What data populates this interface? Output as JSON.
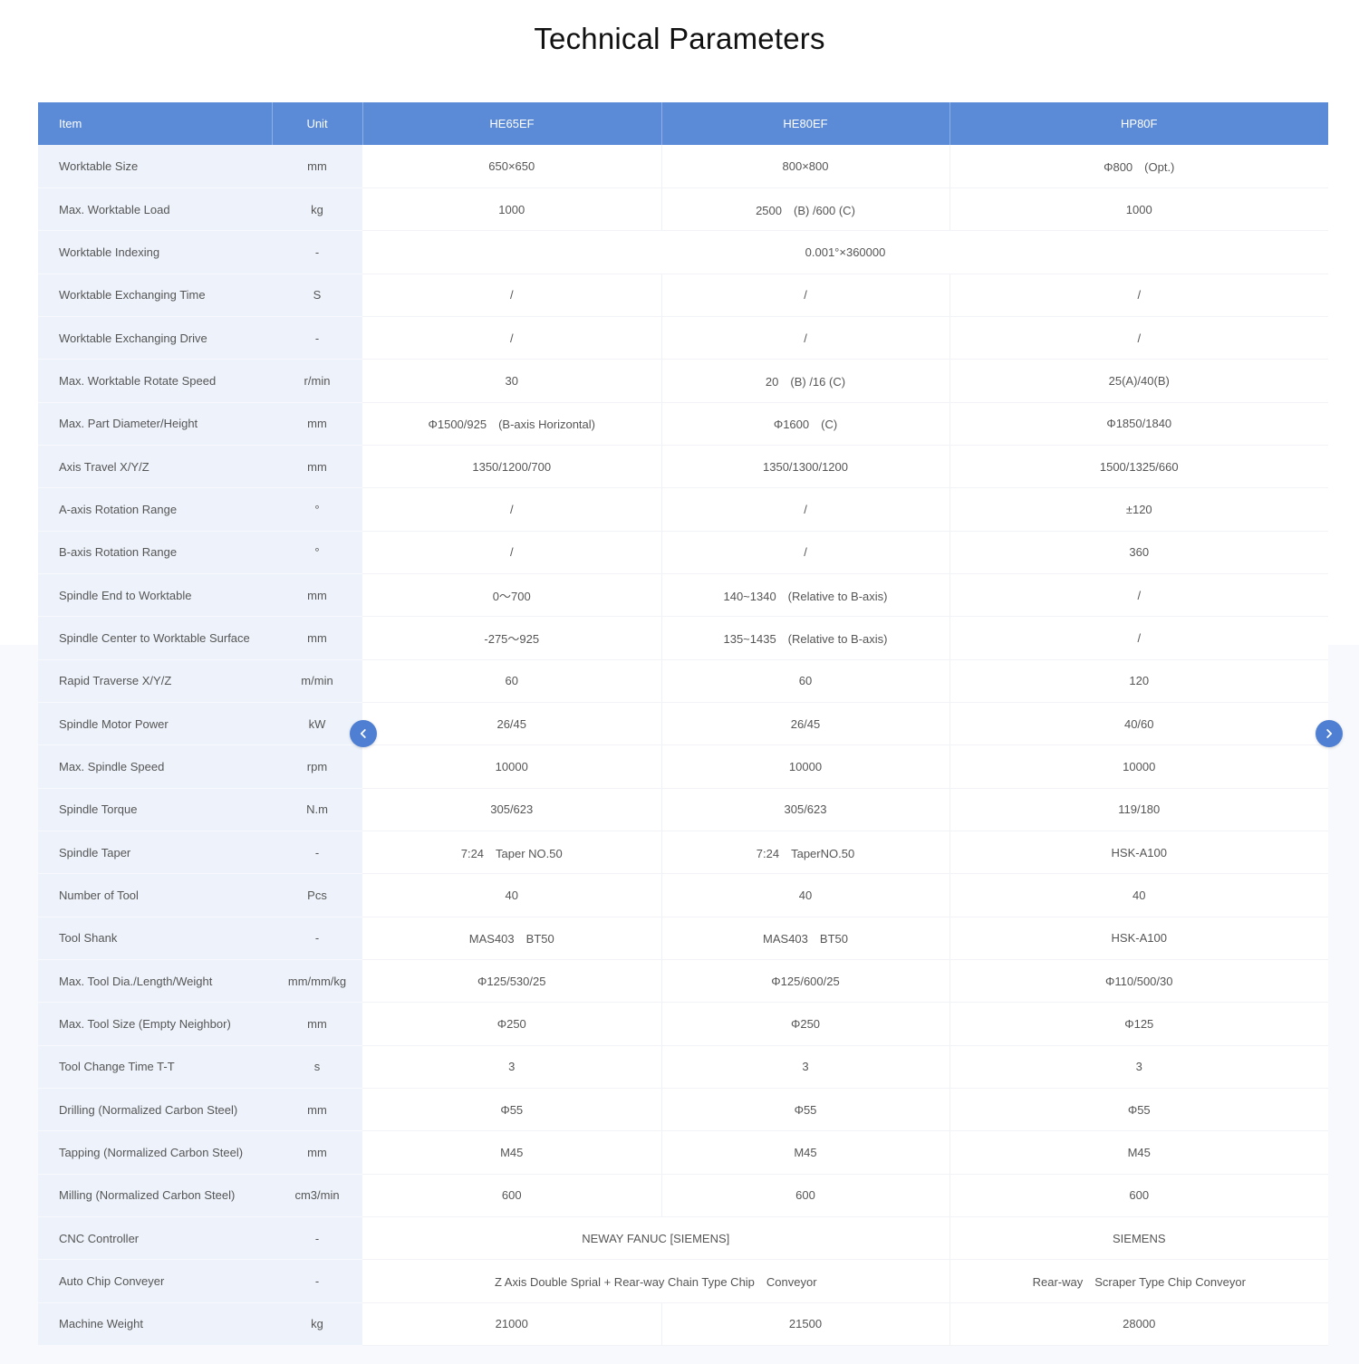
{
  "title": "Technical Parameters",
  "columns": {
    "item": "Item",
    "unit": "Unit",
    "models": [
      "HE65EF",
      "HE80EF",
      "HP80F"
    ]
  },
  "rows": [
    {
      "item": "Worktable Size",
      "unit": "mm",
      "values": [
        "650×650",
        "800×800",
        "Φ800　(Opt.)"
      ]
    },
    {
      "item": "Max. Worktable Load",
      "unit": "kg",
      "values": [
        "1000",
        "2500　(B) /600 (C)",
        "1000"
      ]
    },
    {
      "item": "Worktable Indexing",
      "unit": "-",
      "span": "0.001°×360000"
    },
    {
      "item": "Worktable Exchanging Time",
      "unit": "S",
      "values": [
        "/",
        "/",
        "/"
      ]
    },
    {
      "item": "Worktable Exchanging Drive",
      "unit": "-",
      "values": [
        "/",
        "/",
        "/"
      ]
    },
    {
      "item": "Max. Worktable Rotate Speed",
      "unit": "r/min",
      "values": [
        "30",
        "20　(B) /16 (C)",
        "25(A)/40(B)"
      ]
    },
    {
      "item": "Max. Part Diameter/Height",
      "unit": "mm",
      "values": [
        "Φ1500/925　(B-axis Horizontal)",
        "Φ1600　(C)",
        "Φ1850/1840"
      ]
    },
    {
      "item": "Axis Travel X/Y/Z",
      "unit": "mm",
      "values": [
        "1350/1200/700",
        "1350/1300/1200",
        "1500/1325/660"
      ]
    },
    {
      "item": "A-axis Rotation Range",
      "unit": "°",
      "values": [
        "/",
        "/",
        "±120"
      ]
    },
    {
      "item": "B-axis Rotation Range",
      "unit": "°",
      "values": [
        "/",
        "/",
        "360"
      ]
    },
    {
      "item": "Spindle End to Worktable",
      "unit": "mm",
      "values": [
        "0～700",
        "140~1340　(Relative to B-axis)",
        "/"
      ]
    },
    {
      "item": "Spindle Center to Worktable Surface",
      "unit": "mm",
      "values": [
        "-275～925",
        "135~1435　(Relative to B-axis)",
        "/"
      ]
    },
    {
      "item": "Rapid Traverse X/Y/Z",
      "unit": "m/min",
      "values": [
        "60",
        "60",
        "120"
      ]
    },
    {
      "item": "Spindle Motor Power",
      "unit": "kW",
      "values": [
        "26/45",
        "26/45",
        "40/60"
      ]
    },
    {
      "item": "Max. Spindle Speed",
      "unit": "rpm",
      "values": [
        "10000",
        "10000",
        "10000"
      ]
    },
    {
      "item": "Spindle Torque",
      "unit": "N.m",
      "values": [
        "305/623",
        "305/623",
        "119/180"
      ]
    },
    {
      "item": "Spindle Taper",
      "unit": "-",
      "values": [
        "7:24　Taper NO.50",
        "7:24　TaperNO.50",
        "HSK-A100"
      ]
    },
    {
      "item": "Number of Tool",
      "unit": "Pcs",
      "values": [
        "40",
        "40",
        "40"
      ]
    },
    {
      "item": "Tool Shank",
      "unit": "-",
      "values": [
        "MAS403　BT50",
        "MAS403　BT50",
        "HSK-A100"
      ]
    },
    {
      "item": "Max. Tool Dia./Length/Weight",
      "unit": "mm/mm/kg",
      "values": [
        "Φ125/530/25",
        "Φ125/600/25",
        "Φ110/500/30"
      ]
    },
    {
      "item": "Max. Tool Size (Empty Neighbor)",
      "unit": "mm",
      "values": [
        "Φ250",
        "Φ250",
        "Φ125"
      ]
    },
    {
      "item": "Tool Change Time T-T",
      "unit": "s",
      "values": [
        "3",
        "3",
        "3"
      ]
    },
    {
      "item": "Drilling (Normalized Carbon Steel)",
      "unit": "mm",
      "values": [
        "Φ55",
        "Φ55",
        "Φ55"
      ]
    },
    {
      "item": "Tapping (Normalized Carbon Steel)",
      "unit": "mm",
      "values": [
        "M45",
        "M45",
        "M45"
      ]
    },
    {
      "item": "Milling (Normalized Carbon Steel)",
      "unit": "cm3/min",
      "values": [
        "600",
        "600",
        "600"
      ]
    },
    {
      "item": "CNC Controller",
      "unit": "-",
      "pair": [
        "NEWAY FANUC [SIEMENS]",
        "SIEMENS"
      ]
    },
    {
      "item": "Auto Chip Conveyer",
      "unit": "-",
      "pair": [
        "Z Axis Double Sprial + Rear-way Chain Type Chip　Conveyor",
        "Rear-way　Scraper Type Chip Conveyor"
      ]
    },
    {
      "item": "Machine Weight",
      "unit": "kg",
      "values": [
        "21000",
        "21500",
        "28000"
      ]
    }
  ],
  "nav": {
    "prev_icon": "chevron-left-icon",
    "next_icon": "chevron-right-icon"
  },
  "colors": {
    "header_bg": "#5b8ad6",
    "label_bg": "#eef3fb",
    "nav_button": "#4f7fd2"
  }
}
